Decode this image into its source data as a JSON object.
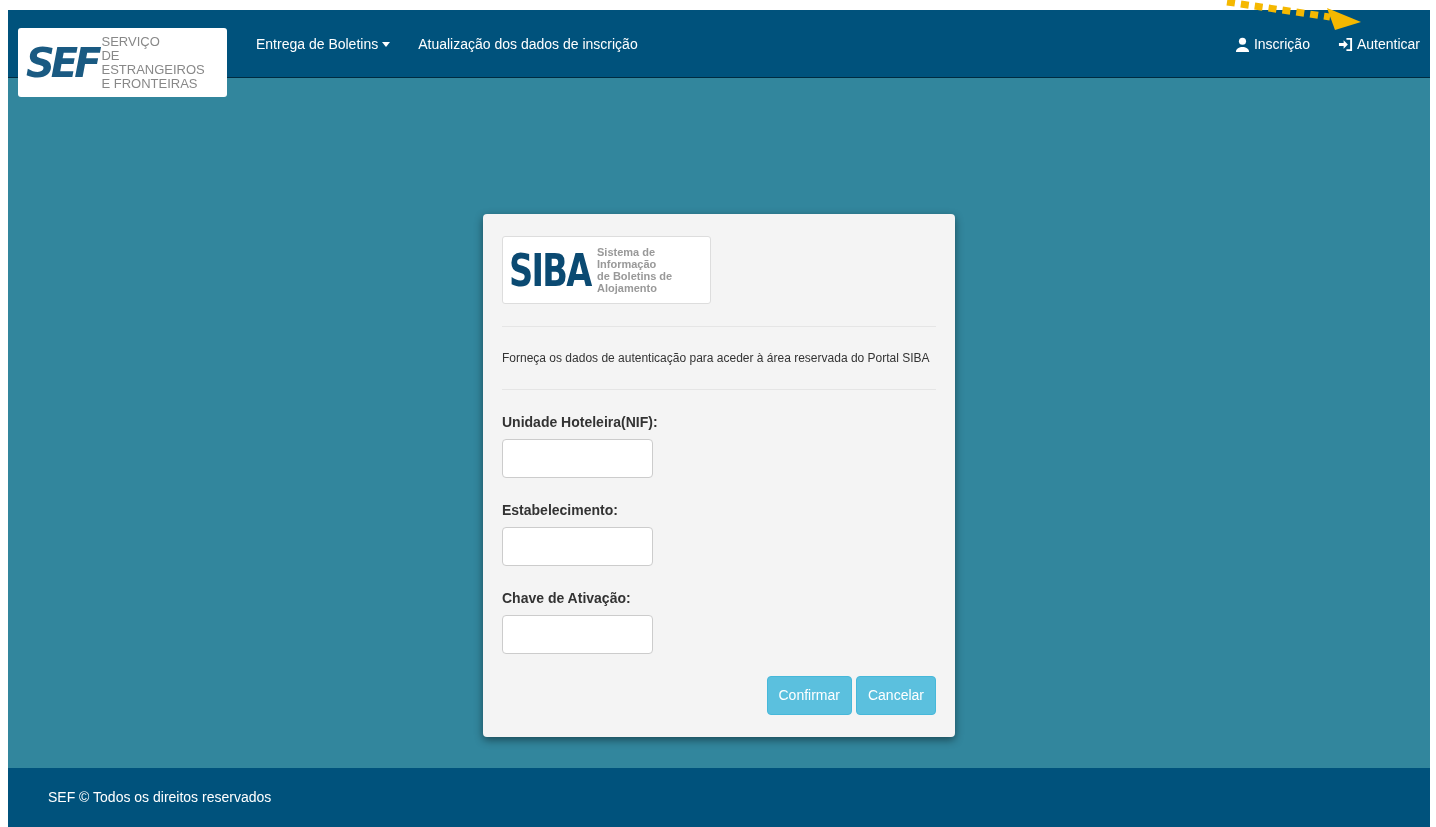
{
  "navbar": {
    "logo": {
      "mark": "SEF",
      "lines": [
        "SERVIÇO",
        "DE ESTRANGEIROS",
        "E FRONTEIRAS"
      ]
    },
    "menu": [
      {
        "label": "Entrega de Boletins",
        "kind": "dropdown"
      },
      {
        "label": "Atualização dos dados de inscrição",
        "kind": "link"
      }
    ],
    "right": [
      {
        "label": "Inscrição",
        "kind": "user"
      },
      {
        "label": "Autenticar",
        "kind": "login"
      }
    ]
  },
  "login_card": {
    "logo": {
      "mark": "SIBA",
      "lines": [
        "Sistema de Informação",
        "de Boletins de",
        "Alojamento"
      ]
    },
    "intro": "Forneça os dados de autenticação para aceder à área reservada do Portal SIBA",
    "fields": [
      {
        "label": "Unidade Hoteleira(NIF):"
      },
      {
        "label": "Estabelecimento:"
      },
      {
        "label": "Chave de Ativação:"
      }
    ],
    "buttons": [
      "Confirmar",
      "Cancelar"
    ]
  },
  "footer": {
    "text": "SEF © Todos os direitos reservados"
  }
}
